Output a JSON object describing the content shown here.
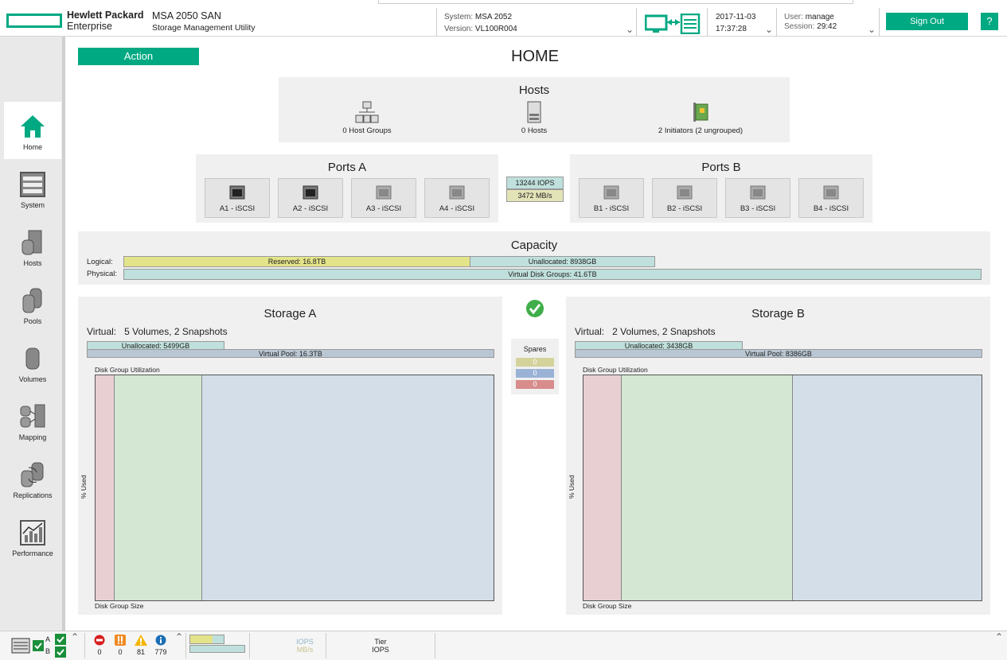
{
  "header": {
    "brand_line1": "Hewlett Packard",
    "brand_line2": "Enterprise",
    "product_title": "MSA 2050 SAN",
    "product_subtitle": "Storage Management Utility",
    "system_key": "System:",
    "system_value": "MSA 2052",
    "version_key": "Version:",
    "version_value": "VL100R004",
    "date": "2017-11-03",
    "time": "17:37:28",
    "user_key": "User:",
    "user_value": "manage",
    "session_key": "Session:",
    "session_value": "29:42",
    "sign_out_label": "Sign Out",
    "help_label": "?"
  },
  "sidebar": {
    "items": [
      {
        "label": "Home",
        "icon": "home-icon",
        "active": true
      },
      {
        "label": "System",
        "icon": "system-icon"
      },
      {
        "label": "Hosts",
        "icon": "hosts-icon"
      },
      {
        "label": "Pools",
        "icon": "pools-icon"
      },
      {
        "label": "Volumes",
        "icon": "volumes-icon"
      },
      {
        "label": "Mapping",
        "icon": "mapping-icon"
      },
      {
        "label": "Replications",
        "icon": "replications-icon"
      },
      {
        "label": "Performance",
        "icon": "performance-icon"
      }
    ]
  },
  "main": {
    "action_label": "Action",
    "page_title": "HOME",
    "hosts": {
      "title": "Hosts",
      "host_groups": "0 Host Groups",
      "hosts": "0 Hosts",
      "initiators": "2 Initiators (2 ungrouped)"
    },
    "ports_a": {
      "title": "Ports A",
      "ports": [
        "A1 - iSCSI",
        "A2 - iSCSI",
        "A3 - iSCSI",
        "A4 - iSCSI"
      ]
    },
    "ports_b": {
      "title": "Ports B",
      "ports": [
        "B1 - iSCSI",
        "B2 - iSCSI",
        "B3 - iSCSI",
        "B4 - iSCSI"
      ]
    },
    "iops": "13244 IOPS",
    "throughput": "3472 MB/s",
    "capacity": {
      "title": "Capacity",
      "logical_label": "Logical:",
      "physical_label": "Physical:",
      "reserved": "Reserved: 16.8TB",
      "unallocated": "Unallocated: 8938GB",
      "virtual_disk_groups": "Virtual Disk Groups: 41.6TB"
    },
    "storage_a": {
      "title": "Storage A",
      "virtual_label": "Virtual:",
      "virtual_value": "5 Volumes, 2 Snapshots",
      "unallocated": "Unallocated: 5499GB",
      "virtual_pool": "Virtual Pool: 16.3TB",
      "chart_title": "Disk Group Utilization",
      "y_label": "% Used",
      "x_label": "Disk Group Size"
    },
    "storage_b": {
      "title": "Storage B",
      "virtual_label": "Virtual:",
      "virtual_value": "2 Volumes, 2 Snapshots",
      "unallocated": "Unallocated: 3438GB",
      "virtual_pool": "Virtual Pool: 8386GB",
      "chart_title": "Disk Group Utilization",
      "y_label": "% Used",
      "x_label": "Disk Group Size"
    },
    "spares": {
      "title": "Spares",
      "values": [
        "0",
        "0",
        "0"
      ]
    }
  },
  "footer": {
    "controller_a": "A",
    "controller_b": "B",
    "critical": "0",
    "error": "0",
    "warning": "81",
    "info": "779",
    "iops_label": "IOPS",
    "mbs_label": "MB/s",
    "tier_label": "Tier",
    "tier_iops_label": "IOPS"
  },
  "colors": {
    "accent": "#01a982",
    "reserved": "#e3e38a",
    "unallocated": "#bfe0dc",
    "tier1": "#e8d0d2",
    "tier2": "#d3e7d3",
    "tier3": "#d3dee8"
  }
}
